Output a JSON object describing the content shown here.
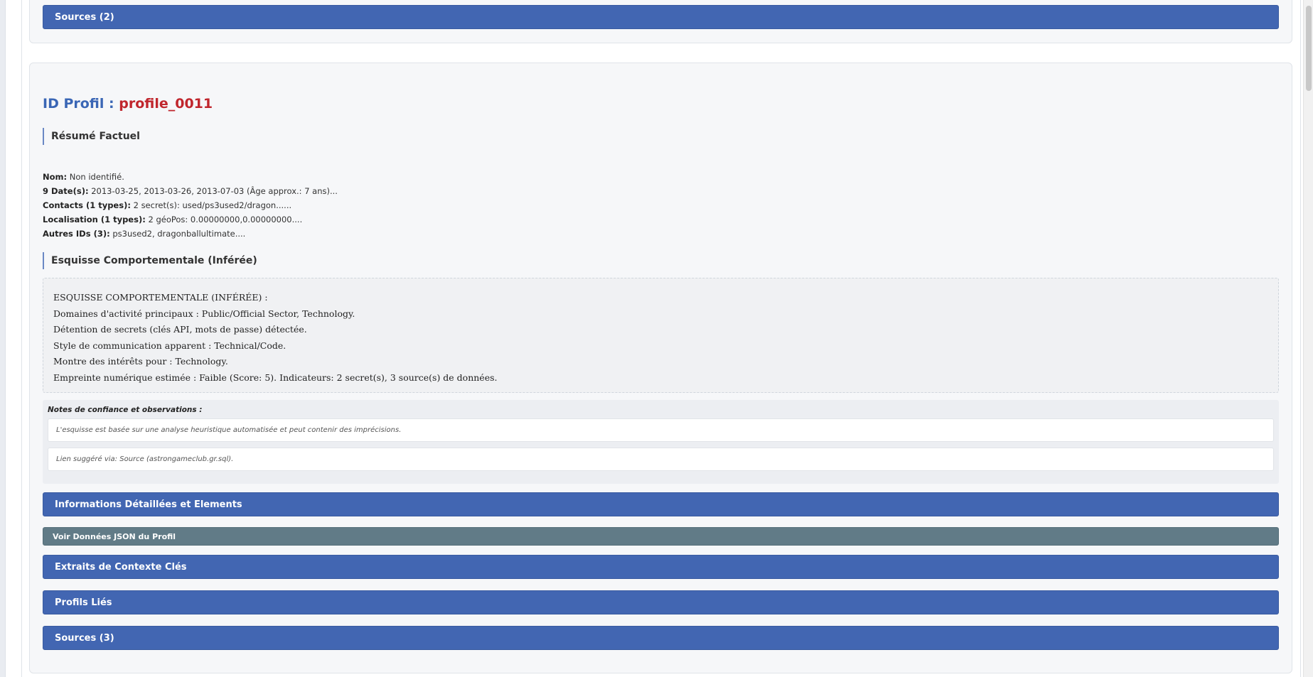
{
  "top_card": {
    "sources_button": "Sources (2)"
  },
  "profile": {
    "id_label": "ID Profil : ",
    "id_value": "profile_0011",
    "factual_summary_title": "Résumé Factuel",
    "facts": [
      {
        "label": "Nom:",
        "value": " Non identifié."
      },
      {
        "label": "9 Date(s):",
        "value": " 2013-03-25, 2013-03-26, 2013-07-03 (Âge approx.: 7 ans)..."
      },
      {
        "label": "Contacts (1 types):",
        "value": " 2 secret(s): used/ps3used2/dragon......"
      },
      {
        "label": "Localisation (1 types):",
        "value": " 2 géoPos: 0.00000000,0.00000000...."
      },
      {
        "label": "Autres IDs (3):",
        "value": " ps3used2, dragonballultimate...."
      }
    ],
    "behavioral_sketch_title": "Esquisse Comportementale (Inférée)",
    "sketch_lines": [
      "ESQUISSE COMPORTEMENTALE (INFÉRÉE) :",
      "Domaines d'activité principaux : Public/Official Sector, Technology.",
      "Détention de secrets (clés API, mots de passe) détectée.",
      "Style de communication apparent : Technical/Code.",
      "Montre des intérêts pour : Technology.",
      "Empreinte numérique estimée : Faible (Score: 5). Indicateurs: 2 secret(s), 3 source(s) de données."
    ],
    "notes_title": "Notes de confiance et observations :",
    "notes": [
      "L'esquisse est basée sur une analyse heuristique automatisée et peut contenir des imprécisions.",
      "Lien suggéré via: Source (astrongameclub.gr.sql)."
    ],
    "buttons": {
      "details": "Informations Détaillées et Elements",
      "json": "Voir Données JSON du Profil",
      "context": "Extraits de Contexte Clés",
      "linked": "Profils Liés",
      "sources": "Sources (3)"
    }
  },
  "colors": {
    "primary_button": "#4266b2",
    "secondary_button": "#617b87",
    "id_label": "#3a66b5",
    "id_value": "#c0262d"
  }
}
